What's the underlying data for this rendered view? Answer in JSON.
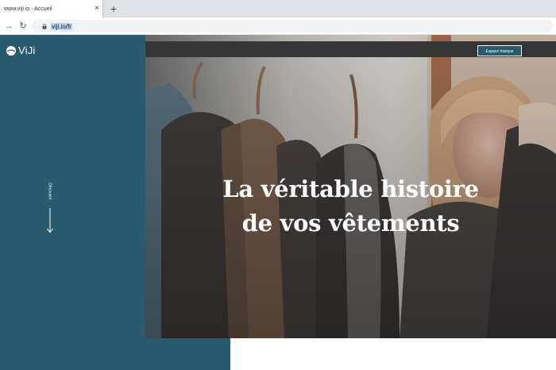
{
  "browser": {
    "tab_title": "www.viji.io - Accueil",
    "close_symbol": "×",
    "new_tab_symbol": "+",
    "back_symbol": "→",
    "reload_symbol": "↻",
    "url": "viji.io/fr"
  },
  "sidebar": {
    "logo_text": "ViJi",
    "discover_label": "Découvrir"
  },
  "hero": {
    "title_line1": "La véritable histoire",
    "title_line2": "de vos vêtements",
    "stamp_button": "Espace marque"
  },
  "colors": {
    "sidebar": "#2a5a6d",
    "text_light": "#ffffff"
  }
}
